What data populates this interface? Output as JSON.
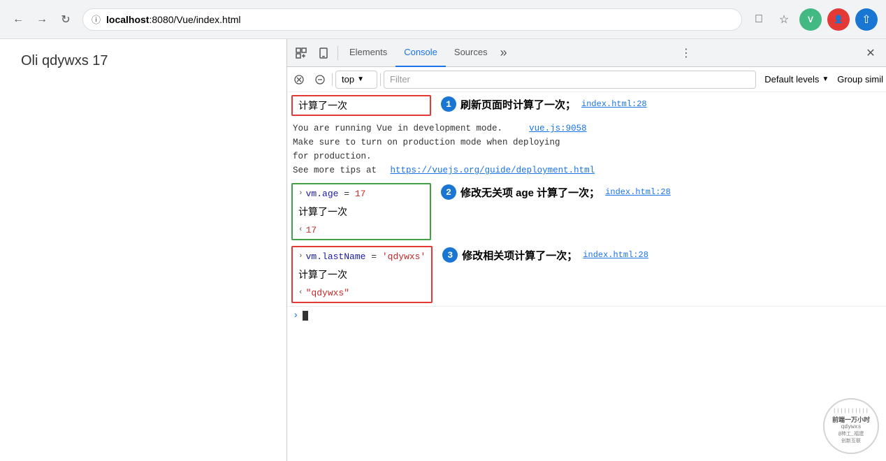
{
  "browser": {
    "url_protocol": "localhost",
    "url_port": ":8080/Vue/index.html",
    "tab_title": "localhost:8080/Vue/index.html"
  },
  "page": {
    "content": "Oli qdywxs 17"
  },
  "devtools": {
    "tabs": [
      "Elements",
      "Console",
      "Sources"
    ],
    "active_tab": "Console",
    "toolbar": {
      "context": "top",
      "filter_placeholder": "Filter",
      "levels": "Default levels",
      "group": "Group simil"
    },
    "console": {
      "annotation1": {
        "bubble": "1",
        "text": "刷新页面时计算了一次；",
        "entry": "计算了一次",
        "link": "index.html:28"
      },
      "vue_warning": {
        "line1": "You are running Vue in development mode.",
        "link1": "vue.js:9058",
        "line2": "Make sure to turn on production mode when deploying",
        "line3": "for production.",
        "line4": "See more tips at",
        "link2": "https://vuejs.org/guide/deployment.html"
      },
      "annotation2": {
        "bubble": "2",
        "text": "修改无关项 age 计算了一次；",
        "entry1_arrow": "›",
        "entry1_cmd": "vm.age = 17",
        "entry2": "计算了一次",
        "link2": "index.html:28",
        "entry3_arrow": "‹",
        "entry3_val": "17"
      },
      "annotation3": {
        "bubble": "3",
        "text": "修改相关项计算了一次；",
        "entry1_arrow": "›",
        "entry1_cmd": "vm.lastName = 'qdywxs'",
        "entry2": "计算了一次",
        "link3": "index.html:28",
        "entry3_arrow": "‹",
        "entry3_val": "\"qdywxs\""
      }
    },
    "watermark": {
      "top": "前端一万小时",
      "user": "qdywxs",
      "bottom1": "@柿工_福建",
      "bottom2": "创新互联"
    }
  }
}
